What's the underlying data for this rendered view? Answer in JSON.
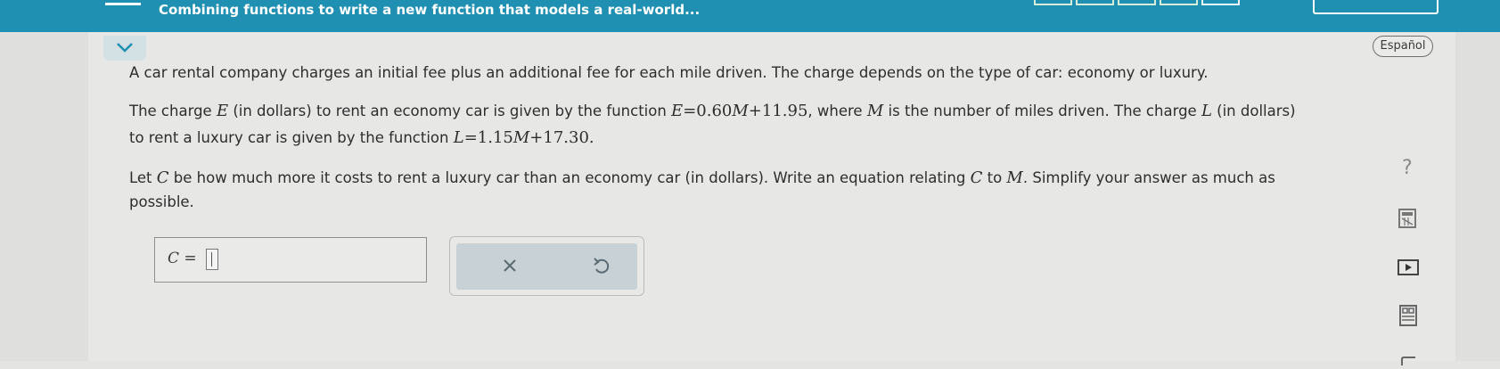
{
  "header": {
    "title": "Combining functions to write a new function that models a real-world..."
  },
  "language_button": "Español",
  "problem": {
    "p1": "A car rental company charges an initial fee plus an additional fee for each mile driven. The charge depends on the type of car: economy or luxury.",
    "p2_a": "The charge ",
    "p2_var_E": "E",
    "p2_b": " (in dollars) to rent an economy car is given by the function ",
    "p2_eq_E": "E",
    "p2_eq_rhs1": "=0.60",
    "p2_eq_M1": "M",
    "p2_eq_rhs2": "+11.95",
    "p2_c": ", where ",
    "p2_var_M": "M",
    "p2_d": " is the number of miles driven. The charge ",
    "p2_var_L": "L",
    "p2_e": " (in dollars)",
    "p3_a": "to rent a luxury car is given by the function ",
    "p3_eq_L": "L",
    "p3_eq_rhs1": "=1.15",
    "p3_eq_M": "M",
    "p3_eq_rhs2": "+17.30.",
    "p4_a": "Let ",
    "p4_var_C": "C",
    "p4_b": " be how much more it costs to rent a luxury car than an economy car (in dollars). Write an equation relating ",
    "p4_var_C2": "C",
    "p4_c": " to ",
    "p4_var_M": "M",
    "p4_d": ". Simplify your answer as much as",
    "p5": "possible."
  },
  "answer": {
    "var": "C",
    "equals": "=",
    "value": ""
  },
  "buttons": {
    "clear": "×"
  },
  "side_tools": {
    "help": "?"
  }
}
